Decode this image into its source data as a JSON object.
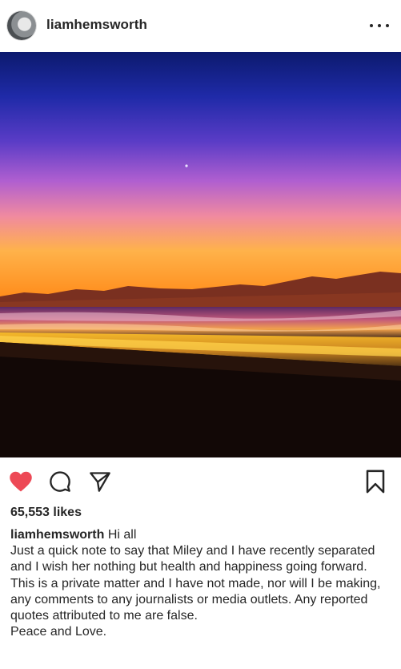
{
  "post": {
    "username": "liamhemsworth",
    "likes": "65,553 likes",
    "liked": true,
    "caption_user": "liamhemsworth",
    "caption_first": "Hi all",
    "caption_lines": [
      "Just a quick note to say that Miley and I have recently separated and I wish her nothing but health and happiness going forward.",
      "This is a private matter and I have not made, nor will I be making, any comments to any journalists or media outlets. Any reported quotes attributed to me are false.",
      "Peace and Love."
    ]
  },
  "icons": {
    "more": "more-options-icon",
    "like": "heart-icon",
    "comment": "comment-icon",
    "share": "share-icon",
    "save": "bookmark-icon"
  },
  "colors": {
    "like_red": "#ed4956",
    "text": "#262626"
  }
}
